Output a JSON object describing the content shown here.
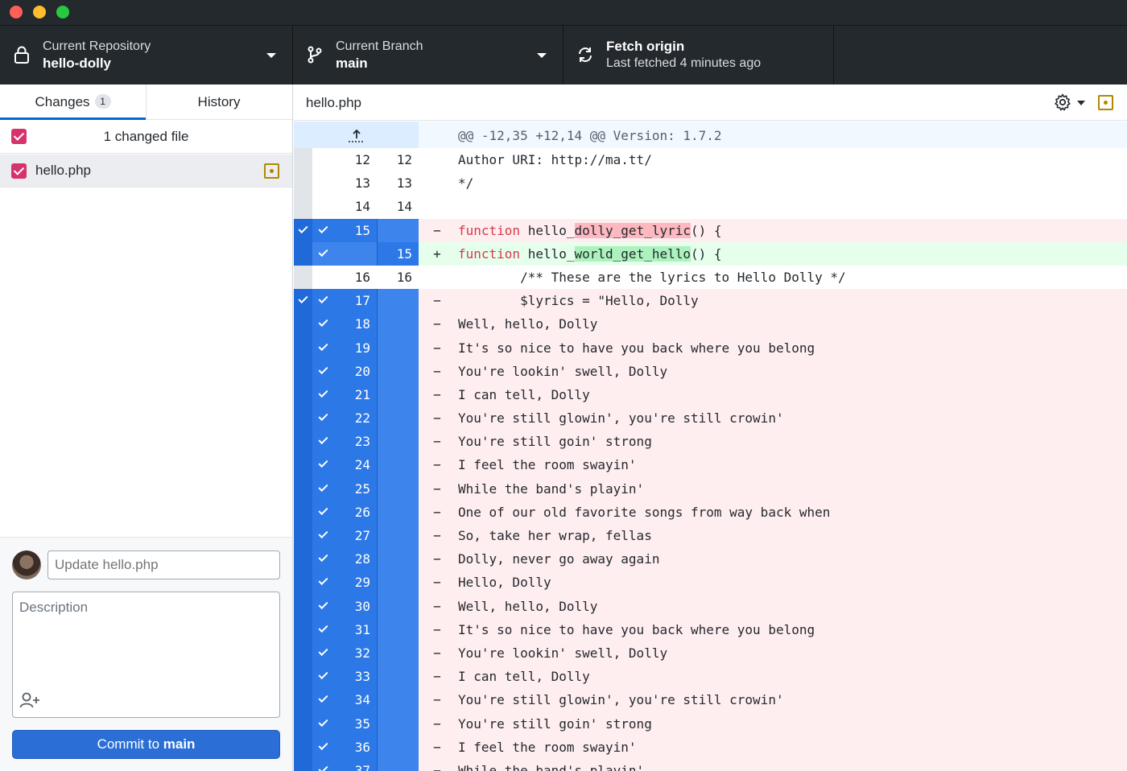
{
  "toolbar": {
    "repo": {
      "label": "Current Repository",
      "value": "hello-dolly"
    },
    "branch": {
      "label": "Current Branch",
      "value": "main"
    },
    "fetch": {
      "label": "Fetch origin",
      "value": "Last fetched 4 minutes ago"
    }
  },
  "sidebar": {
    "tabs": [
      {
        "label": "Changes",
        "badge": "1"
      },
      {
        "label": "History"
      }
    ],
    "changed_count": "1 changed file",
    "files": [
      {
        "name": "hello.php"
      }
    ]
  },
  "commit": {
    "summary_placeholder": "Update hello.php",
    "description_placeholder": "Description",
    "button_prefix": "Commit to ",
    "button_branch": "main"
  },
  "diff": {
    "file_name": "hello.php",
    "hunk_header": "@@ -12,35 +12,14 @@ Version: 1.7.2",
    "lines": [
      {
        "type": "ctx",
        "old": "12",
        "new": "12",
        "text": "Author URI: http://ma.tt/"
      },
      {
        "type": "ctx",
        "old": "13",
        "new": "13",
        "text": "*/"
      },
      {
        "type": "ctx",
        "old": "14",
        "new": "14",
        "text": ""
      },
      {
        "type": "del",
        "old": "15",
        "new": "",
        "sel": true,
        "kw": "function",
        "pre": " hello_",
        "hl": "dolly_get_lyric",
        "post": "() {"
      },
      {
        "type": "add",
        "old": "",
        "new": "15",
        "sel": true,
        "kw": "function",
        "pre": " hello_",
        "hl": "world_get_hello",
        "post": "() {"
      },
      {
        "type": "ctx",
        "old": "16",
        "new": "16",
        "text": "        /** These are the lyrics to Hello Dolly */"
      },
      {
        "type": "del",
        "old": "17",
        "new": "",
        "sel": true,
        "text": "        $lyrics = \"Hello, Dolly"
      },
      {
        "type": "del",
        "old": "18",
        "new": "",
        "sel": true,
        "text": "Well, hello, Dolly"
      },
      {
        "type": "del",
        "old": "19",
        "new": "",
        "sel": true,
        "text": "It's so nice to have you back where you belong"
      },
      {
        "type": "del",
        "old": "20",
        "new": "",
        "sel": true,
        "text": "You're lookin' swell, Dolly"
      },
      {
        "type": "del",
        "old": "21",
        "new": "",
        "sel": true,
        "text": "I can tell, Dolly"
      },
      {
        "type": "del",
        "old": "22",
        "new": "",
        "sel": true,
        "text": "You're still glowin', you're still crowin'"
      },
      {
        "type": "del",
        "old": "23",
        "new": "",
        "sel": true,
        "text": "You're still goin' strong"
      },
      {
        "type": "del",
        "old": "24",
        "new": "",
        "sel": true,
        "text": "I feel the room swayin'"
      },
      {
        "type": "del",
        "old": "25",
        "new": "",
        "sel": true,
        "text": "While the band's playin'"
      },
      {
        "type": "del",
        "old": "26",
        "new": "",
        "sel": true,
        "text": "One of our old favorite songs from way back when"
      },
      {
        "type": "del",
        "old": "27",
        "new": "",
        "sel": true,
        "text": "So, take her wrap, fellas"
      },
      {
        "type": "del",
        "old": "28",
        "new": "",
        "sel": true,
        "text": "Dolly, never go away again"
      },
      {
        "type": "del",
        "old": "29",
        "new": "",
        "sel": true,
        "text": "Hello, Dolly"
      },
      {
        "type": "del",
        "old": "30",
        "new": "",
        "sel": true,
        "text": "Well, hello, Dolly"
      },
      {
        "type": "del",
        "old": "31",
        "new": "",
        "sel": true,
        "text": "It's so nice to have you back where you belong"
      },
      {
        "type": "del",
        "old": "32",
        "new": "",
        "sel": true,
        "text": "You're lookin' swell, Dolly"
      },
      {
        "type": "del",
        "old": "33",
        "new": "",
        "sel": true,
        "text": "I can tell, Dolly"
      },
      {
        "type": "del",
        "old": "34",
        "new": "",
        "sel": true,
        "text": "You're still glowin', you're still crowin'"
      },
      {
        "type": "del",
        "old": "35",
        "new": "",
        "sel": true,
        "text": "You're still goin' strong"
      },
      {
        "type": "del",
        "old": "36",
        "new": "",
        "sel": true,
        "text": "I feel the room swayin'"
      },
      {
        "type": "del",
        "old": "37",
        "new": "",
        "sel": true,
        "text": "While the band's playin'"
      }
    ]
  },
  "colors": {
    "toolbar_bg": "#24292e",
    "accent_blue": "#2b6fd6",
    "checkbox_pink": "#d6336c",
    "deleted_bg": "#ffeef0",
    "added_bg": "#e6ffed",
    "modified_icon": "#b08800"
  },
  "icons": [
    "lock-icon",
    "branch-icon",
    "sync-icon",
    "gear-icon",
    "expand-up-icon",
    "add-coauthor-icon",
    "file-modified-icon"
  ]
}
